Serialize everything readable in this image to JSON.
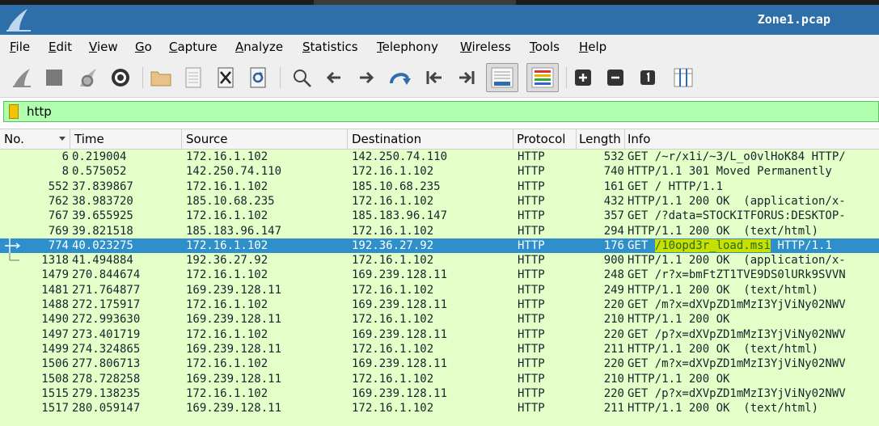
{
  "window": {
    "title": "Zone1.pcap"
  },
  "menu": [
    "File",
    "Edit",
    "View",
    "Go",
    "Capture",
    "Analyze",
    "Statistics",
    "Telephony",
    "Wireless",
    "Tools",
    "Help"
  ],
  "toolbar": {
    "icons": [
      "start-capture-icon",
      "stop-capture-icon",
      "restart-capture-icon",
      "capture-options-icon",
      "open-file-icon",
      "save-file-icon",
      "close-file-icon",
      "reload-file-icon",
      "find-packet-icon",
      "go-back-icon",
      "go-forward-icon",
      "go-to-packet-icon",
      "first-packet-icon",
      "last-packet-icon",
      "autoscroll-icon",
      "colorize-icon",
      "zoom-in-icon",
      "zoom-out-icon",
      "normal-size-icon",
      "resize-columns-icon"
    ]
  },
  "filter": {
    "value": "http"
  },
  "columns": {
    "no": "No.",
    "time": "Time",
    "source": "Source",
    "destination": "Destination",
    "protocol": "Protocol",
    "length": "Length",
    "info": "Info"
  },
  "packets": [
    {
      "no": "6",
      "time": "0.219004",
      "src": "172.16.1.102",
      "dst": "142.250.74.110",
      "proto": "HTTP",
      "len": "532",
      "info_pre": "GET /~r/x1i/~3/L_o0vlHoK84 HTTP/",
      "info_hl": "",
      "info_post": ""
    },
    {
      "no": "8",
      "time": "0.575052",
      "src": "142.250.74.110",
      "dst": "172.16.1.102",
      "proto": "HTTP",
      "len": "740",
      "info_pre": "HTTP/1.1 301 Moved Permanently",
      "info_hl": "",
      "info_post": ""
    },
    {
      "no": "552",
      "time": "37.839867",
      "src": "172.16.1.102",
      "dst": "185.10.68.235",
      "proto": "HTTP",
      "len": "161",
      "info_pre": "GET / HTTP/1.1",
      "info_hl": "",
      "info_post": ""
    },
    {
      "no": "762",
      "time": "38.983720",
      "src": "185.10.68.235",
      "dst": "172.16.1.102",
      "proto": "HTTP",
      "len": "432",
      "info_pre": "HTTP/1.1 200 OK  (application/x-",
      "info_hl": "",
      "info_post": ""
    },
    {
      "no": "767",
      "time": "39.655925",
      "src": "172.16.1.102",
      "dst": "185.183.96.147",
      "proto": "HTTP",
      "len": "357",
      "info_pre": "GET /?data=STOCKITFORUS:DESKTOP-",
      "info_hl": "",
      "info_post": ""
    },
    {
      "no": "769",
      "time": "39.821518",
      "src": "185.183.96.147",
      "dst": "172.16.1.102",
      "proto": "HTTP",
      "len": "294",
      "info_pre": "HTTP/1.1 200 OK  (text/html)",
      "info_hl": "",
      "info_post": ""
    },
    {
      "no": "774",
      "time": "40.023275",
      "src": "172.16.1.102",
      "dst": "192.36.27.92",
      "proto": "HTTP",
      "len": "176",
      "info_pre": "GET ",
      "info_hl": "/10opd3r_load.msi",
      "info_post": " HTTP/1.1",
      "selected": true
    },
    {
      "no": "1318",
      "time": "41.494884",
      "src": "192.36.27.92",
      "dst": "172.16.1.102",
      "proto": "HTTP",
      "len": "900",
      "info_pre": "HTTP/1.1 200 OK  (application/x-",
      "info_hl": "",
      "info_post": ""
    },
    {
      "no": "1479",
      "time": "270.844674",
      "src": "172.16.1.102",
      "dst": "169.239.128.11",
      "proto": "HTTP",
      "len": "248",
      "info_pre": "GET /r?x=bmFtZT1TVE9DS0lURk9SVVN",
      "info_hl": "",
      "info_post": ""
    },
    {
      "no": "1481",
      "time": "271.764877",
      "src": "169.239.128.11",
      "dst": "172.16.1.102",
      "proto": "HTTP",
      "len": "249",
      "info_pre": "HTTP/1.1 200 OK  (text/html)",
      "info_hl": "",
      "info_post": ""
    },
    {
      "no": "1488",
      "time": "272.175917",
      "src": "172.16.1.102",
      "dst": "169.239.128.11",
      "proto": "HTTP",
      "len": "220",
      "info_pre": "GET /m?x=dXVpZD1mMzI3YjViNy02NWV",
      "info_hl": "",
      "info_post": ""
    },
    {
      "no": "1490",
      "time": "272.993630",
      "src": "169.239.128.11",
      "dst": "172.16.1.102",
      "proto": "HTTP",
      "len": "210",
      "info_pre": "HTTP/1.1 200 OK",
      "info_hl": "",
      "info_post": ""
    },
    {
      "no": "1497",
      "time": "273.401719",
      "src": "172.16.1.102",
      "dst": "169.239.128.11",
      "proto": "HTTP",
      "len": "220",
      "info_pre": "GET /p?x=dXVpZD1mMzI3YjViNy02NWV",
      "info_hl": "",
      "info_post": ""
    },
    {
      "no": "1499",
      "time": "274.324865",
      "src": "169.239.128.11",
      "dst": "172.16.1.102",
      "proto": "HTTP",
      "len": "211",
      "info_pre": "HTTP/1.1 200 OK  (text/html)",
      "info_hl": "",
      "info_post": ""
    },
    {
      "no": "1506",
      "time": "277.806713",
      "src": "172.16.1.102",
      "dst": "169.239.128.11",
      "proto": "HTTP",
      "len": "220",
      "info_pre": "GET /m?x=dXVpZD1mMzI3YjViNy02NWV",
      "info_hl": "",
      "info_post": ""
    },
    {
      "no": "1508",
      "time": "278.728258",
      "src": "169.239.128.11",
      "dst": "172.16.1.102",
      "proto": "HTTP",
      "len": "210",
      "info_pre": "HTTP/1.1 200 OK",
      "info_hl": "",
      "info_post": ""
    },
    {
      "no": "1515",
      "time": "279.138235",
      "src": "172.16.1.102",
      "dst": "169.239.128.11",
      "proto": "HTTP",
      "len": "220",
      "info_pre": "GET /p?x=dXVpZD1mMzI3YjViNy02NWV",
      "info_hl": "",
      "info_post": ""
    },
    {
      "no": "1517",
      "time": "280.059147",
      "src": "169.239.128.11",
      "dst": "172.16.1.102",
      "proto": "HTTP",
      "len": "211",
      "info_pre": "HTTP/1.1 200 OK  (text/html)",
      "info_hl": "",
      "info_post": ""
    }
  ],
  "colors": {
    "row_bg": "#e4ffc7",
    "selected_bg": "#2f8fca",
    "filter_ok_bg": "#afffaf",
    "titlebar_bg": "#2f6fa9",
    "highlight": "#c8e000"
  }
}
